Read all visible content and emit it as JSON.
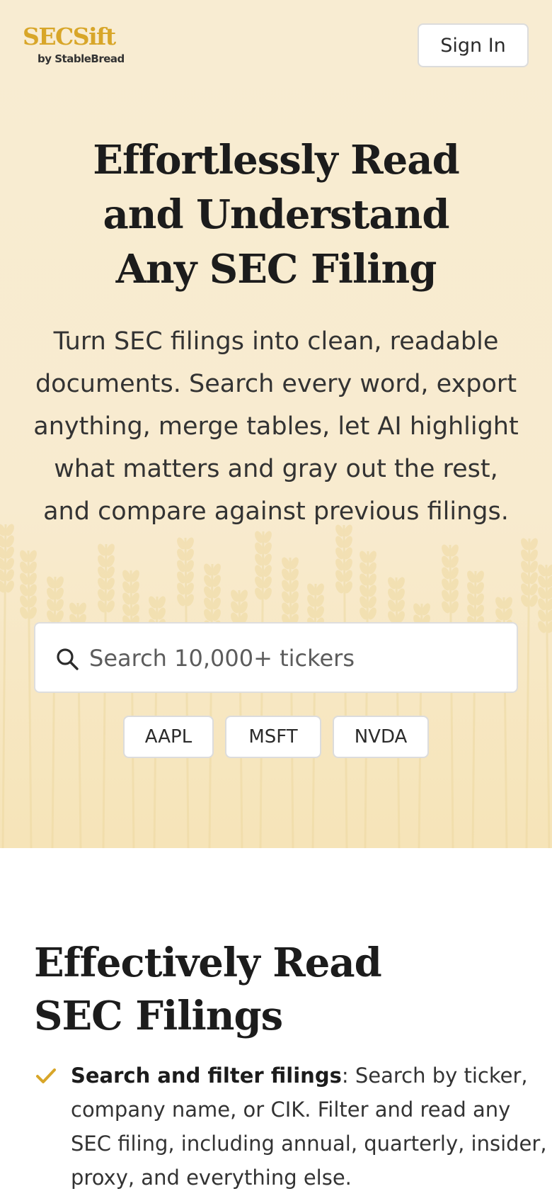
{
  "brand": {
    "name": "SECSift",
    "byline": "by StableBread",
    "accent_color": "#d8a629"
  },
  "header": {
    "sign_in_label": "Sign In"
  },
  "hero": {
    "title_lines": [
      "Effortlessly Read",
      "and Understand",
      "Any SEC Filing"
    ],
    "description": "Turn SEC filings into clean, readable documents. Search every word, export anything, merge tables, let AI highlight what matters and gray out the rest, and compare against previous filings.",
    "background_color": "#f8ecd2"
  },
  "search": {
    "placeholder": "Search 10,000+ tickers",
    "value": "",
    "icon": "search-icon"
  },
  "ticker_chips": [
    "AAPL",
    "MSFT",
    "NVDA"
  ],
  "features": {
    "title_lines": [
      "Effectively Read",
      "SEC Filings"
    ],
    "items": [
      {
        "icon": "check-icon",
        "title": "Search and filter filings",
        "separator": ": ",
        "body": "Search by ticker, company name, or CIK. Filter and read any SEC filing, including annual, quarterly, insider, proxy, and everything else."
      }
    ]
  }
}
